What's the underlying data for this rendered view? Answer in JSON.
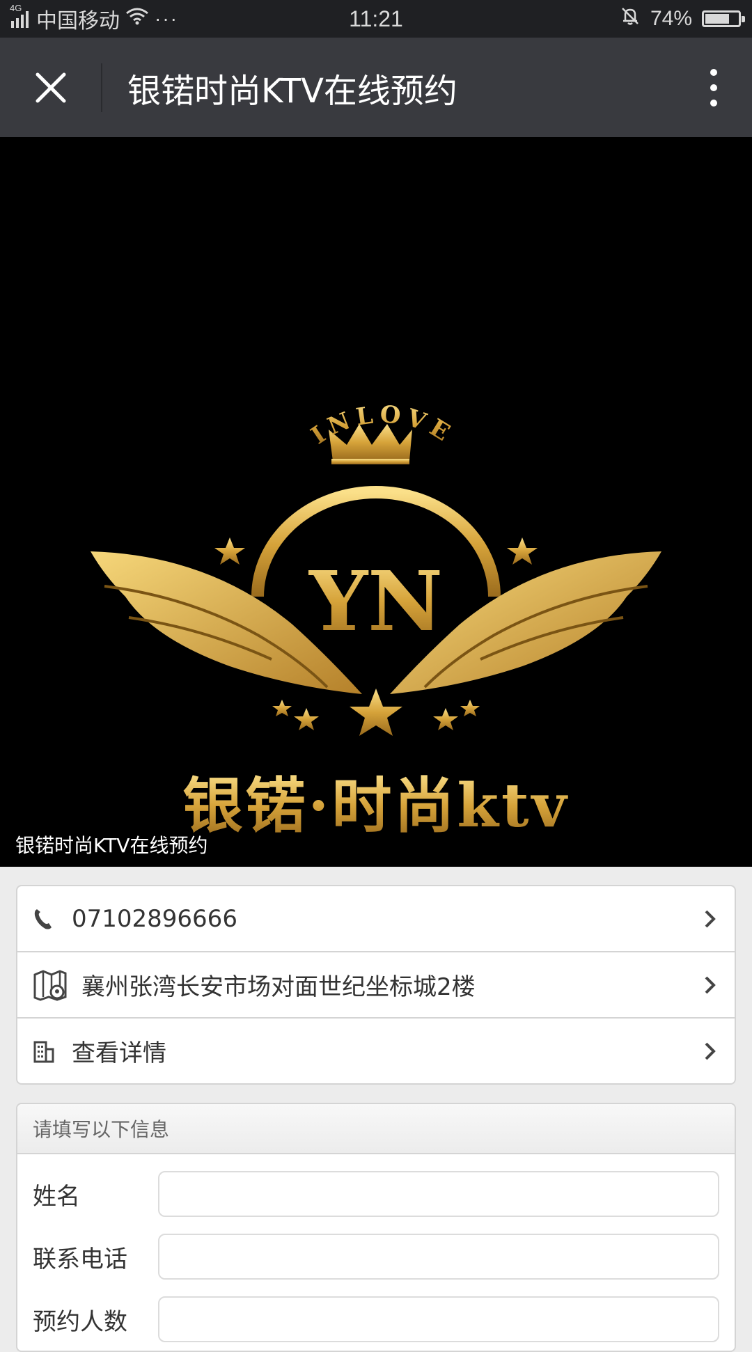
{
  "status_bar": {
    "network": "4G",
    "carrier": "中国移动",
    "more": "···",
    "time": "11:21",
    "battery_percent": "74%",
    "battery_level": 0.74
  },
  "navbar": {
    "title": "银锘时尚KTV在线预约"
  },
  "banner": {
    "logo_arc_text": "INLOVE",
    "logo_monogram": "YN",
    "logo_brand": "银锘·时尚ktv",
    "caption": "银锘时尚KTV在线预约"
  },
  "info": {
    "phone": "07102896666",
    "address": "襄州张湾长安市场对面世纪坐标城2楼",
    "details": "查看详情"
  },
  "form": {
    "header": "请填写以下信息",
    "name_label": "姓名",
    "phone_label": "联系电话",
    "people_label": "预约人数"
  }
}
